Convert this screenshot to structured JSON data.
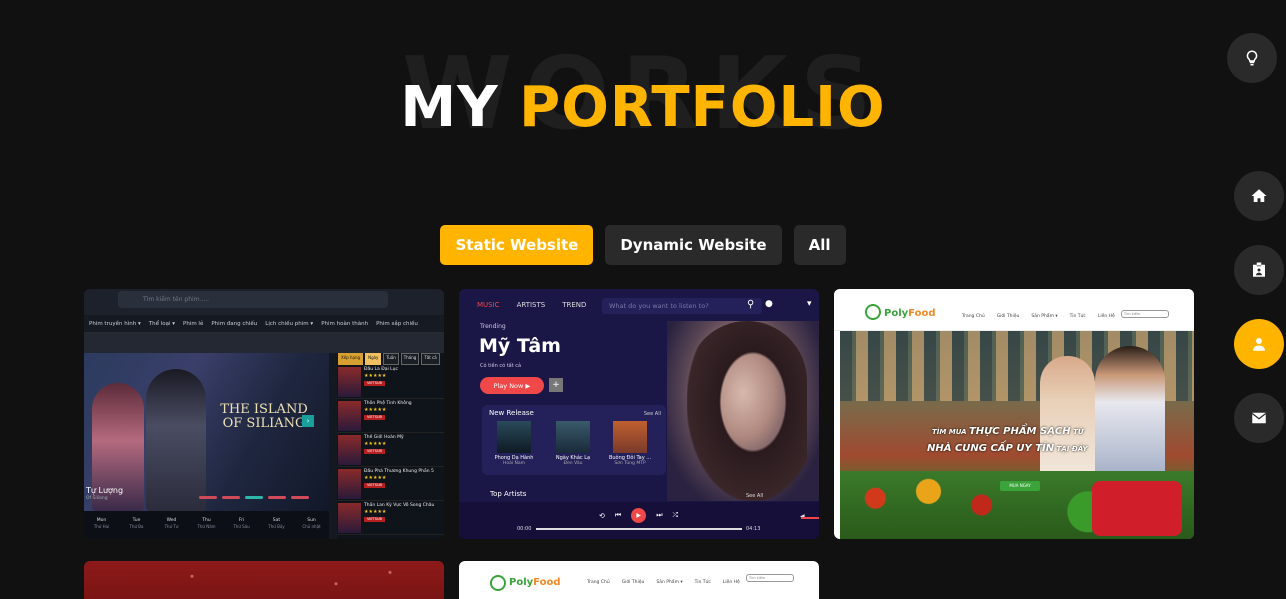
{
  "header": {
    "background_word": "WORKS",
    "title_white": "MY",
    "title_accent": "PORTFOLIO"
  },
  "colors": {
    "accent": "#ffb400",
    "background": "#111111",
    "button": "#2b2a2a"
  },
  "filters": [
    {
      "label": "Static Website",
      "active": true
    },
    {
      "label": "Dynamic Website",
      "active": false
    },
    {
      "label": "All",
      "active": false
    }
  ],
  "side_nav": [
    {
      "icon": "lightbulb-icon",
      "active": false
    },
    {
      "icon": "home-icon",
      "active": false
    },
    {
      "icon": "id-card-icon",
      "active": false
    },
    {
      "icon": "user-icon",
      "active": true
    },
    {
      "icon": "envelope-icon",
      "active": false
    }
  ],
  "works": {
    "movie": {
      "search_placeholder": "Tìm kiếm tên phim.....",
      "menu": [
        "Phim truyền hình ▾",
        "Thể loại ▾",
        "Phim lẻ",
        "Phim đang chiếu",
        "Lịch chiếu phim ▾",
        "Phim hoàn thành",
        "Phim sắp chiếu"
      ],
      "hero_logo": "THE ISLAND OF SILIANG",
      "hero_name": "Tự Lượng",
      "hero_sub": "Of Siliang",
      "rank_tabs": [
        "Xếp hạng",
        "Ngày",
        "Tuần",
        "Tháng",
        "Tất cả"
      ],
      "rank_items": [
        {
          "title": "Đấu La Đại Lục",
          "badge": "VIETSUB"
        },
        {
          "title": "Thôn Phệ Tinh Không",
          "badge": "VIETSUB"
        },
        {
          "title": "Thế Giới Hoàn Mỹ",
          "badge": "VIETSUB"
        },
        {
          "title": "Đấu Phá Thương Khung Phần 5",
          "badge": "VIETSUB"
        },
        {
          "title": "Thần Lan Kỳ Vực Vô Song Châu",
          "badge": "VIETSUB"
        }
      ],
      "days": [
        {
          "en": "Mon",
          "vi": "Thứ Hai"
        },
        {
          "en": "Tue",
          "vi": "Thứ Ba"
        },
        {
          "en": "Wed",
          "vi": "Thứ Tư"
        },
        {
          "en": "Thu",
          "vi": "Thứ Năm"
        },
        {
          "en": "Fri",
          "vi": "Thứ Sáu"
        },
        {
          "en": "Sat",
          "vi": "Thứ Bảy"
        },
        {
          "en": "Sun",
          "vi": "Chủ nhật"
        }
      ]
    },
    "music": {
      "nav": [
        "MUSIC",
        "ARTISTS",
        "TREND"
      ],
      "search_placeholder": "What do you want to listen to?",
      "trending": "Trending",
      "artist": "Mỹ Tâm",
      "desc": "Có tiền có tất cả",
      "play_label": "Play Now ▶",
      "plus": "+",
      "new_release": "New Release",
      "see_all": "See All",
      "releases": [
        {
          "title": "Phong Dạ Hành",
          "artist": "Hoài Nam"
        },
        {
          "title": "Ngày Khác Lạ",
          "artist": "Đen Vâu"
        },
        {
          "title": "Buông Đôi Tay ...",
          "artist": "Sơn Tùng MTP"
        }
      ],
      "top_artists": "Top Artists",
      "see_all_2": "See All",
      "time_start": "00:00",
      "time_end": "04:13"
    },
    "food": {
      "brand_a": "Poly",
      "brand_b": "Food",
      "menu": [
        "Trang Chủ",
        "Giới Thiệu",
        "Sản Phẩm ▾",
        "Tin Tức",
        "Liên Hệ"
      ],
      "search_placeholder": "Tìm kiếm",
      "slogan1_a": "TÌM MUA ",
      "slogan1_b": "THỰC PHẨM SẠCH",
      "slogan1_c": " TỪ",
      "slogan2_a": "NHÀ CUNG CẤP UY TÍN",
      "slogan2_b": " TẠI ĐÂY",
      "buy_now": "MUA NGAY"
    },
    "food2": {
      "brand_a": "Poly",
      "brand_b": "Food",
      "menu": [
        "Trang Chủ",
        "Giới Thiệu",
        "Sản Phẩm ▾",
        "Tin Tức",
        "Liên Hệ"
      ],
      "search_placeholder": "Tìm kiếm"
    }
  }
}
